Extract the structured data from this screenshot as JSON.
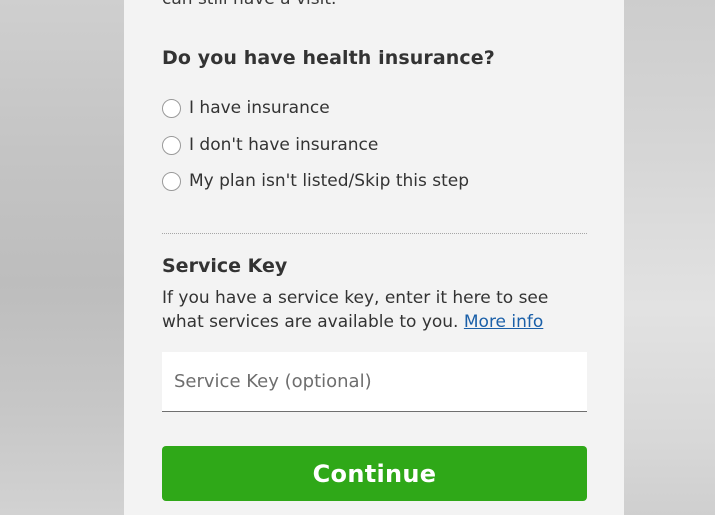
{
  "intro": {
    "clipped_text": "can still have a visit."
  },
  "insurance": {
    "question": "Do you have health insurance?",
    "options": [
      {
        "label": "I have insurance",
        "selected": false
      },
      {
        "label": "I don't have insurance",
        "selected": false
      },
      {
        "label": "My plan isn't listed/Skip this step",
        "selected": false
      }
    ]
  },
  "service_key": {
    "title": "Service Key",
    "description": "If you have a service key, enter it here to see what services are available to you.",
    "more_info_link": "More info",
    "input_placeholder": "Service Key (optional)",
    "input_value": ""
  },
  "actions": {
    "continue_label": "Continue",
    "continue_color": "#2fa818"
  },
  "colors": {
    "link": "#1a5fa8",
    "panel_bg": "#f3f3f3",
    "text": "#333333"
  }
}
